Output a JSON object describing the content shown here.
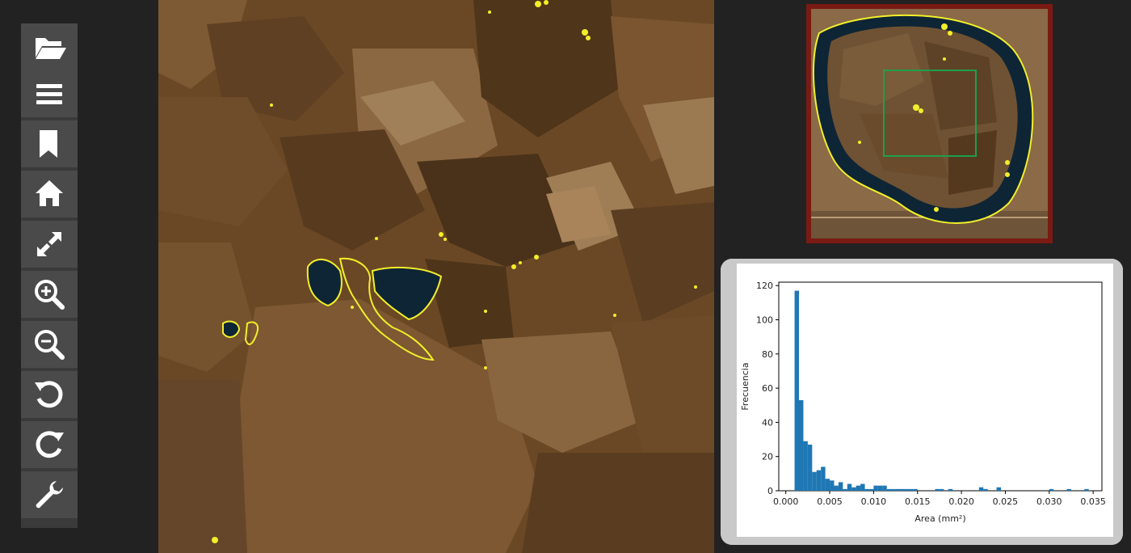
{
  "toolbar": {
    "items": [
      {
        "icon": "folder-open-icon",
        "action": "open"
      },
      {
        "icon": "menu-icon",
        "action": "menu"
      },
      {
        "icon": "bookmark-icon",
        "action": "bookmark"
      },
      {
        "icon": "home-icon",
        "action": "home"
      },
      {
        "icon": "fullscreen-icon",
        "action": "fullscreen"
      },
      {
        "icon": "zoom-in-icon",
        "action": "zoom-in"
      },
      {
        "icon": "zoom-out-icon",
        "action": "zoom-out"
      },
      {
        "icon": "rotate-left-icon",
        "action": "rotate-left"
      },
      {
        "icon": "rotate-right-icon",
        "action": "rotate-right"
      },
      {
        "icon": "wrench-icon",
        "action": "settings"
      }
    ]
  },
  "colors": {
    "background": "#222222",
    "toolbar_button": "#4a4a4a",
    "rock": "#6e4a26",
    "annotation": "#f2ef2a",
    "pore": "#0e2536",
    "minimap_border": "#7a1a12",
    "viewport_rect": "#1f9e4a",
    "histogram_bar": "#1f77b4",
    "panel": "#c9c9c9"
  },
  "chart_data": {
    "type": "bar",
    "xlabel": "Area (mm²)",
    "ylabel": "Frecuencia",
    "xlim": [
      -0.0008,
      0.036
    ],
    "ylim": [
      0,
      122
    ],
    "xticks": [
      "0.000",
      "0.005",
      "0.010",
      "0.015",
      "0.020",
      "0.025",
      "0.030",
      "0.035"
    ],
    "yticks": [
      "0",
      "20",
      "40",
      "60",
      "80",
      "100",
      "120"
    ],
    "bin_width": 0.0005,
    "bins_start": [
      0.001,
      0.0015,
      0.002,
      0.0025,
      0.003,
      0.0035,
      0.004,
      0.0045,
      0.005,
      0.0055,
      0.006,
      0.0065,
      0.007,
      0.0075,
      0.008,
      0.0085,
      0.009,
      0.0095,
      0.01,
      0.0105,
      0.011,
      0.0115,
      0.012,
      0.0125,
      0.013,
      0.0135,
      0.014,
      0.0145,
      0.017,
      0.0175,
      0.0185,
      0.022,
      0.0225,
      0.024,
      0.03,
      0.032,
      0.034
    ],
    "values": [
      117,
      53,
      29,
      27,
      11,
      12,
      14,
      7,
      6,
      3,
      5,
      1,
      4,
      2,
      3,
      4,
      1,
      1,
      3,
      3,
      3,
      1,
      1,
      1,
      1,
      1,
      1,
      1,
      1,
      1,
      1,
      2,
      1,
      2,
      1,
      1,
      1
    ]
  }
}
